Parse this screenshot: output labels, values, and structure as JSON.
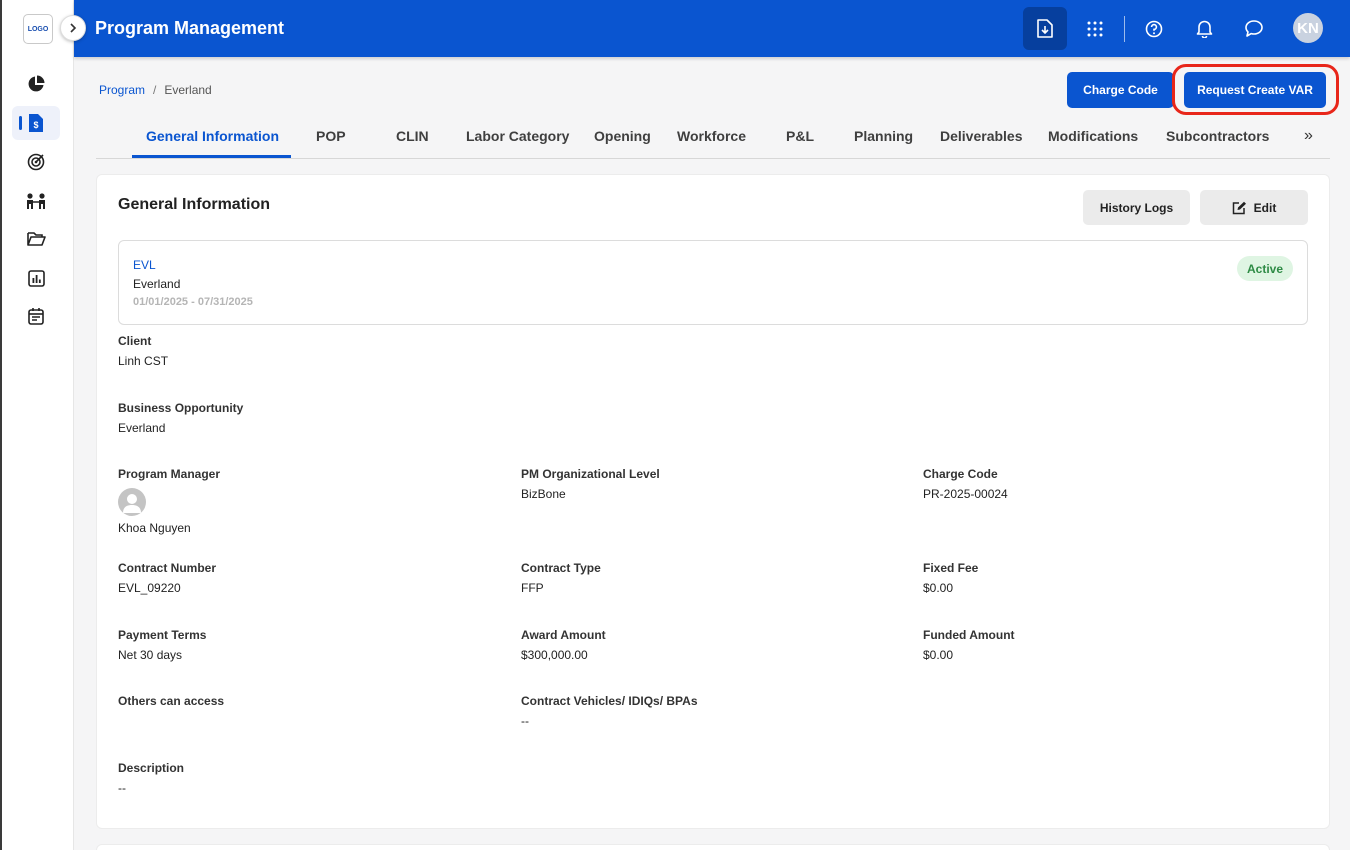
{
  "sidebar": {
    "logo_text": "LOGO",
    "items": [
      {
        "icon": "pie-chart-icon"
      },
      {
        "icon": "billing-document-icon",
        "active": true
      },
      {
        "icon": "target-icon"
      },
      {
        "icon": "team-icon"
      },
      {
        "icon": "folder-open-icon"
      },
      {
        "icon": "report-chart-icon"
      },
      {
        "icon": "calendar-icon"
      }
    ]
  },
  "header": {
    "title": "Program Management",
    "icons": [
      "download-document-icon",
      "apps-grid-icon",
      "help-icon",
      "bell-icon",
      "chat-icon"
    ],
    "avatar_initials": "KN",
    "accent_color": "#0a55d0"
  },
  "breadcrumb": {
    "root": "Program",
    "separator": "/",
    "current": "Everland"
  },
  "actions": {
    "charge_code_label": "Charge Code",
    "request_var_label": "Request Create VAR"
  },
  "tabs": [
    {
      "label": "General Information",
      "active": true
    },
    {
      "label": "POP"
    },
    {
      "label": "CLIN"
    },
    {
      "label": "Labor Category"
    },
    {
      "label": "Opening"
    },
    {
      "label": "Workforce"
    },
    {
      "label": "P&L"
    },
    {
      "label": "Planning"
    },
    {
      "label": "Deliverables"
    },
    {
      "label": "Modifications"
    },
    {
      "label": "Subcontractors"
    }
  ],
  "tabs_more": "»",
  "card": {
    "title": "General Information",
    "history_label": "History Logs",
    "edit_label": "Edit",
    "summary": {
      "code": "EVL",
      "name": "Everland",
      "dates": "01/01/2025 - 07/31/2025",
      "status": "Active"
    },
    "fields": {
      "client": {
        "label": "Client",
        "value": "Linh CST"
      },
      "business_opportunity": {
        "label": "Business Opportunity",
        "value": "Everland"
      },
      "program_manager": {
        "label": "Program Manager",
        "value": "Khoa Nguyen"
      },
      "pm_org_level": {
        "label": "PM Organizational Level",
        "value": "BizBone"
      },
      "charge_code": {
        "label": "Charge Code",
        "value": "PR-2025-00024"
      },
      "contract_number": {
        "label": "Contract Number",
        "value": "EVL_09220"
      },
      "contract_type": {
        "label": "Contract Type",
        "value": "FFP"
      },
      "fixed_fee": {
        "label": "Fixed Fee",
        "value": "$0.00"
      },
      "payment_terms": {
        "label": "Payment Terms",
        "value": "Net 30 days"
      },
      "award_amount": {
        "label": "Award Amount",
        "value": "$300,000.00"
      },
      "funded_amount": {
        "label": "Funded Amount",
        "value": "$0.00"
      },
      "others_access": {
        "label": "Others can access",
        "value": ""
      },
      "contract_vehicles": {
        "label": "Contract Vehicles/ IDIQs/ BPAs",
        "value": "--"
      },
      "description": {
        "label": "Description",
        "value": "--"
      }
    }
  }
}
